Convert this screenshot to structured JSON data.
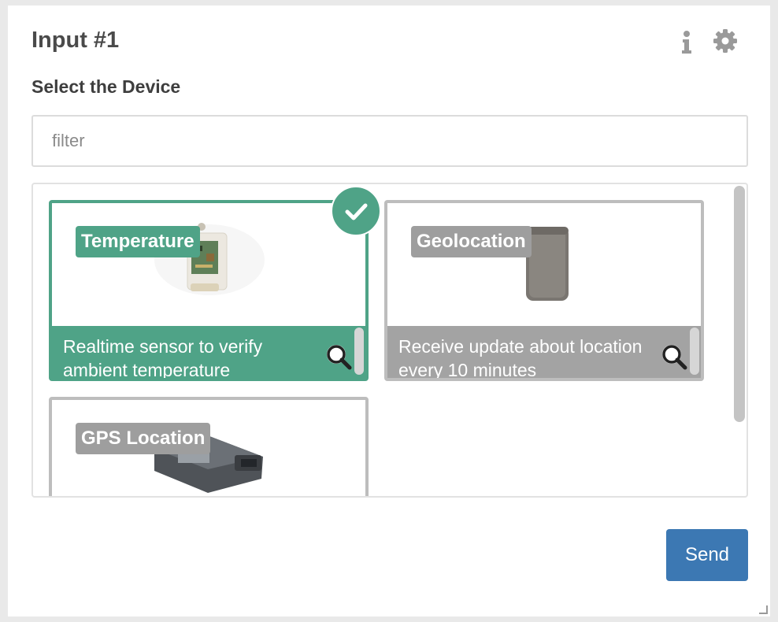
{
  "panel": {
    "title": "Input #1",
    "info_icon": "info-icon",
    "settings_icon": "gear-icon"
  },
  "section": {
    "label": "Select the Device"
  },
  "filter": {
    "placeholder": "filter",
    "value": ""
  },
  "devices": [
    {
      "title": "Temperature",
      "description": "Realtime sensor to verify ambient temperature",
      "selected": true,
      "image": "circuit-board-sensor",
      "zoom_icon": "magnifier-icon"
    },
    {
      "title": "Geolocation",
      "description": "Receive update about location every 10 minutes",
      "selected": false,
      "image": "gray-tracker-box",
      "zoom_icon": "magnifier-icon"
    },
    {
      "title": "GPS Location",
      "description": "",
      "selected": false,
      "image": "obd-gps-dongle",
      "zoom_icon": "magnifier-icon"
    }
  ],
  "send_button": {
    "label": "Send"
  },
  "colors": {
    "accent_green": "#4fa387",
    "card_gray": "#a3a3a3",
    "send_blue": "#3c78b3",
    "title_text": "#4a4a4a"
  }
}
